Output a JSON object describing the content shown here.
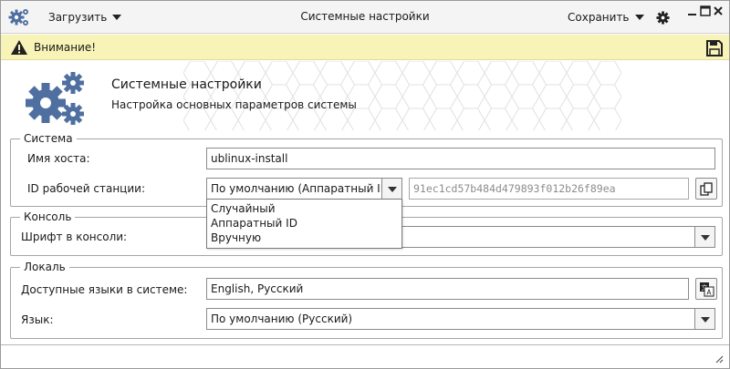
{
  "titlebar": {
    "load_label": "Загрузить",
    "title": "Системные настройки",
    "save_label": "Сохранить"
  },
  "warning": {
    "text": "Внимание!"
  },
  "header": {
    "title": "Системные настройки",
    "subtitle": "Настройка основных параметров системы"
  },
  "system": {
    "legend": "Система",
    "hostname_label": "Имя хоста:",
    "hostname_value": "ublinux-install",
    "workstation_label": "ID рабочей станции:",
    "workstation_selected": "По умолчанию (Аппаратный ID)",
    "workstation_id": "91ec1cd57b484d479893f012b26f89ea",
    "dropdown_options": [
      "Случайный",
      "Аппаратный ID",
      "Вручную"
    ]
  },
  "console": {
    "legend": "Консоль",
    "font_label": "Шрифт в консоли:",
    "font_value": ""
  },
  "locale": {
    "legend": "Локаль",
    "languages_label": "Доступные языки в системе:",
    "languages_value": "English, Русский",
    "language_label": "Язык:",
    "language_value": "По умолчанию (Русский)"
  },
  "colors": {
    "accent": "#4f6fa0",
    "warning_bg": "#f8f3b7"
  },
  "icons": {
    "app": "gears-icon",
    "settings": "gear-icon",
    "warning": "warning-triangle-icon",
    "save": "floppy-disk-icon",
    "copy": "copy-icon",
    "language": "translate-icon"
  }
}
